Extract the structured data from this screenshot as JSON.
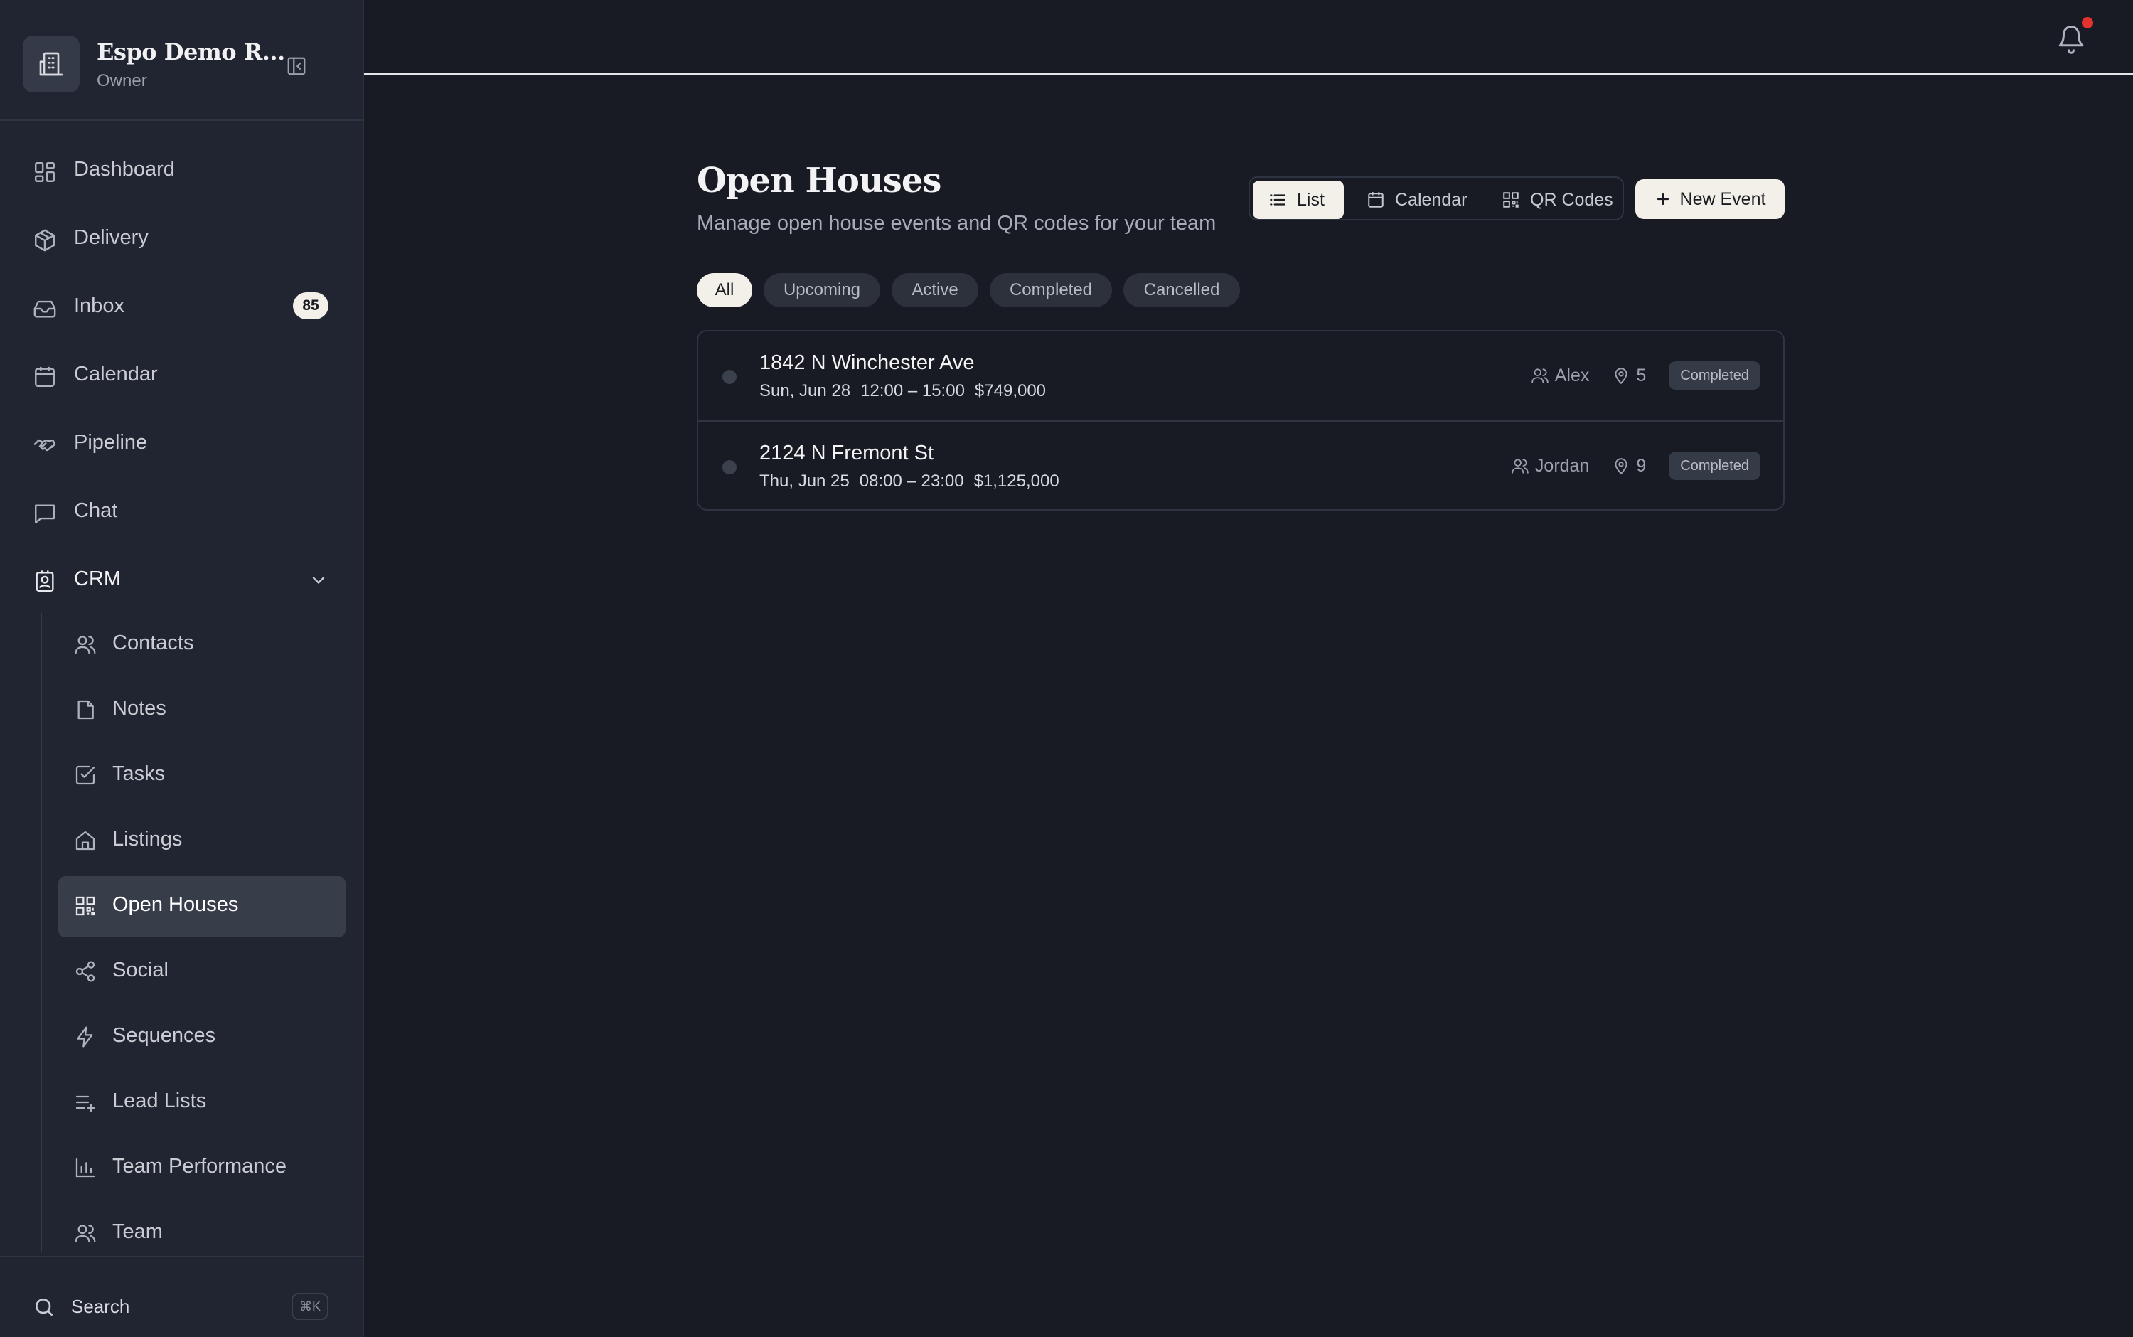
{
  "sidebar": {
    "brand_name": "Espo Demo R...",
    "brand_role": "Owner",
    "nav": [
      {
        "label": "Dashboard",
        "icon": "dashboard-icon"
      },
      {
        "label": "Delivery",
        "icon": "package-icon"
      },
      {
        "label": "Inbox",
        "icon": "inbox-icon",
        "badge": "85"
      },
      {
        "label": "Calendar",
        "icon": "calendar-icon"
      },
      {
        "label": "Pipeline",
        "icon": "handshake-icon"
      },
      {
        "label": "Chat",
        "icon": "chat-icon"
      },
      {
        "label": "CRM",
        "icon": "contact-book-icon",
        "expanded": true
      }
    ],
    "crm_items": [
      {
        "label": "Contacts",
        "icon": "users-icon"
      },
      {
        "label": "Notes",
        "icon": "note-icon"
      },
      {
        "label": "Tasks",
        "icon": "checkbox-icon"
      },
      {
        "label": "Listings",
        "icon": "home-icon"
      },
      {
        "label": "Open Houses",
        "icon": "qr-code-icon",
        "active": true
      },
      {
        "label": "Social",
        "icon": "share-icon"
      },
      {
        "label": "Sequences",
        "icon": "lightning-icon"
      },
      {
        "label": "Lead Lists",
        "icon": "list-plus-icon"
      },
      {
        "label": "Team Performance",
        "icon": "bar-chart-icon"
      },
      {
        "label": "Team",
        "icon": "users-icon"
      }
    ],
    "search_label": "Search",
    "search_shortcut": "⌘K"
  },
  "page": {
    "title": "Open Houses",
    "subtitle": "Manage open house events and QR codes for your team",
    "views": [
      {
        "label": "List",
        "active": true
      },
      {
        "label": "Calendar",
        "active": false
      },
      {
        "label": "QR Codes",
        "active": false
      }
    ],
    "new_event_label": "New Event",
    "filters": [
      "All",
      "Upcoming",
      "Active",
      "Completed",
      "Cancelled"
    ],
    "active_filter": "All"
  },
  "events": [
    {
      "address": "1842 N Winchester Ave",
      "date": "Sun, Jun 28",
      "time": "12:00 – 15:00",
      "price": "$749,000",
      "agent": "Alex",
      "visitors": "5",
      "status": "Completed"
    },
    {
      "address": "2124 N Fremont St",
      "date": "Thu, Jun 25",
      "time": "08:00 – 23:00",
      "price": "$1,125,000",
      "agent": "Jordan",
      "visitors": "9",
      "status": "Completed"
    }
  ],
  "colors": {
    "background": "#181b23",
    "sidebar": "#212531",
    "accent_light": "#f3f0ea",
    "notification_dot": "#e5322f"
  }
}
